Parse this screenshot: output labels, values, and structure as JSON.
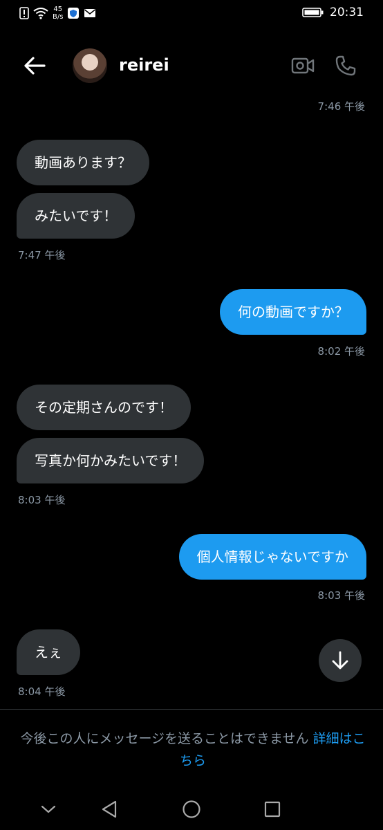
{
  "status_bar": {
    "time": "20:31",
    "net_speed_value": "45",
    "net_speed_unit": "B/s",
    "icons": [
      "alert-icon",
      "wifi-icon",
      "shield-app-icon",
      "mail-icon",
      "battery-icon"
    ]
  },
  "header": {
    "username": "reirei",
    "icons": [
      "back-arrow-icon",
      "video-call-icon",
      "phone-icon"
    ]
  },
  "conversation": {
    "ts_top": "7:46 午後",
    "msg1": "動画あります？",
    "msg2": "みたいです！",
    "ts1": "7:47 午後",
    "msg3": "何の動画ですか？",
    "ts2": "8:02 午後",
    "msg4": "その定期さんのです！",
    "msg5": "写真か何かみたいです！",
    "ts3": "8:03 午後",
    "msg6": "個人情報じゃないですか",
    "ts4": "8:03 午後",
    "msg7": "えぇ",
    "ts5": "8:04 午後"
  },
  "footer": {
    "notice_text": "今後この人にメッセージを送ることはできません",
    "notice_link": "詳細はこちら"
  },
  "nav_bar": {
    "icons": [
      "chevron-down-icon",
      "back-triangle-icon",
      "home-circle-icon",
      "recents-square-icon"
    ]
  },
  "colors": {
    "background": "#000000",
    "incoming_bubble": "#2f3336",
    "outgoing_bubble": "#1d9bf0",
    "timestamp": "#8b98a5",
    "link": "#1d9bf0"
  }
}
